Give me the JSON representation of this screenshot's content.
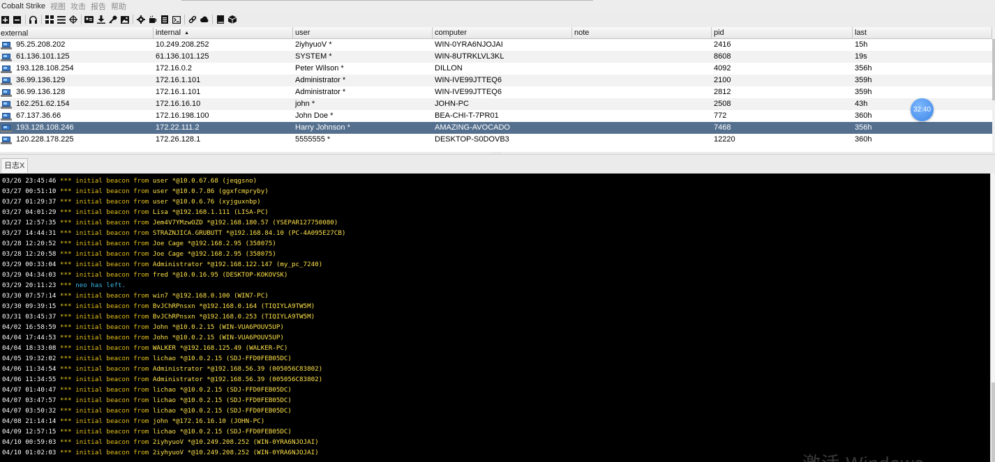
{
  "menubar": {
    "app_name": "Cobalt Strike",
    "items": [
      "视图",
      "攻击",
      "报告",
      "帮助"
    ]
  },
  "toolbar": {
    "icons": [
      "connect-icon",
      "disconnect-icon",
      "headphones-icon",
      "pivot-graph-icon",
      "session-list-icon",
      "target-crosshair-icon",
      "credentials-icon",
      "download-icon",
      "key-icon",
      "screenshot-icon",
      "settings-gear-icon",
      "coffee-icon",
      "document-icon",
      "console-icon",
      "link-icon",
      "cloud-icon",
      "book-icon",
      "cube-icon"
    ]
  },
  "beacon_table": {
    "columns": [
      {
        "key": "external",
        "label": "external"
      },
      {
        "key": "internal",
        "label": "internal",
        "sort": "▲"
      },
      {
        "key": "user",
        "label": "user"
      },
      {
        "key": "computer",
        "label": "computer"
      },
      {
        "key": "note",
        "label": "note"
      },
      {
        "key": "pid",
        "label": "pid"
      },
      {
        "key": "last",
        "label": "last"
      }
    ],
    "rows": [
      {
        "external": "95.25.208.202",
        "internal": "10.249.208.252",
        "user": "2iyhyuoV *",
        "computer": "WIN-0YRA6NJOJAI",
        "note": "",
        "pid": "2416",
        "last": "15h"
      },
      {
        "external": "61.136.101.125",
        "internal": "61.136.101.125",
        "user": "SYSTEM *",
        "computer": "WIN-8UTRKLVL3KL",
        "note": "",
        "pid": "8608",
        "last": "19s"
      },
      {
        "external": "193.128.108.254",
        "internal": "172.16.0.2",
        "user": "Peter Wilson *",
        "computer": "DILLON",
        "note": "",
        "pid": "4092",
        "last": "356h"
      },
      {
        "external": "36.99.136.129",
        "internal": "172.16.1.101",
        "user": "Administrator *",
        "computer": "WIN-IVE99JTTEQ6",
        "note": "",
        "pid": "2100",
        "last": "359h"
      },
      {
        "external": "36.99.136.128",
        "internal": "172.16.1.101",
        "user": "Administrator *",
        "computer": "WIN-IVE99JTTEQ6",
        "note": "",
        "pid": "2812",
        "last": "359h"
      },
      {
        "external": "162.251.62.154",
        "internal": "172.16.16.10",
        "user": "john *",
        "computer": "JOHN-PC",
        "note": "",
        "pid": "2508",
        "last": "43h"
      },
      {
        "external": "67.137.36.66",
        "internal": "172.16.198.100",
        "user": "John Doe *",
        "computer": "BEA-CHI-T-7PR01",
        "note": "",
        "pid": "772",
        "last": "360h"
      },
      {
        "external": "193.128.108.246",
        "internal": "172.22.111.2",
        "user": "Harry Johnson *",
        "computer": "AMAZING-AVOCADO",
        "note": "",
        "pid": "7468",
        "last": "356h",
        "selected": true
      },
      {
        "external": "120.228.178.225",
        "internal": "172.26.128.1",
        "user": "5555555 *",
        "computer": "DESKTOP-S0DOVB3",
        "note": "",
        "pid": "12220",
        "last": "360h"
      }
    ]
  },
  "timer_badge": "32:40",
  "log_tab": {
    "label": "日志X"
  },
  "event_log": [
    {
      "time": "03/26 23:45:46",
      "stars": "***",
      "text": "initial beacon from",
      "who": "user *@10.0.67.68 (jeqgsno)"
    },
    {
      "time": "03/27 00:51:10",
      "stars": "***",
      "text": "initial beacon from",
      "who": "user *@10.0.7.86 (ggxfcmpryby)"
    },
    {
      "time": "03/27 01:29:37",
      "stars": "***",
      "text": "initial beacon from",
      "who": "user *@10.0.6.76 (xyjguxnbp)"
    },
    {
      "time": "03/27 04:01:29",
      "stars": "***",
      "text": "initial beacon from",
      "who": "Lisa *@192.168.1.111 (LISA-PC)"
    },
    {
      "time": "03/27 12:57:35",
      "stars": "***",
      "text": "initial beacon from",
      "who": "Jem4V7YMzwOZD *@192.168.180.57 (YSEPAR127750080)"
    },
    {
      "time": "03/27 14:44:31",
      "stars": "***",
      "text": "initial beacon from",
      "who": "STRAZNJICA.GRUBUTT *@192.168.84.10 (PC-4A095E27CB)"
    },
    {
      "time": "03/28 12:20:52",
      "stars": "***",
      "text": "initial beacon from",
      "who": "Joe Cage *@192.168.2.95 (358075)"
    },
    {
      "time": "03/28 12:20:58",
      "stars": "***",
      "text": "initial beacon from",
      "who": "Joe Cage *@192.168.2.95 (358075)"
    },
    {
      "time": "03/29 00:33:04",
      "stars": "***",
      "text": "initial beacon from",
      "who": "Administrator *@192.168.122.147 (my_pc_7240)"
    },
    {
      "time": "03/29 04:34:03",
      "stars": "***",
      "text": "initial beacon from",
      "who": "fred *@10.0.16.95 (DESKTOP-KOKOVSK)"
    },
    {
      "time": "03/29 20:11:23",
      "stars": "***",
      "text": "neo has left.",
      "who": "",
      "style": "cyan"
    },
    {
      "time": "03/30 07:57:14",
      "stars": "***",
      "text": "initial beacon from",
      "who": "win7 *@192.168.0.100 (WIN7-PC)"
    },
    {
      "time": "03/30 09:39:15",
      "stars": "***",
      "text": "initial beacon from",
      "who": "BvJChRPnsxn *@192.168.0.164 (TIQIYLA9TW5M)"
    },
    {
      "time": "03/31 03:45:37",
      "stars": "***",
      "text": "initial beacon from",
      "who": "BvJChRPnsxn *@192.168.0.253 (TIQIYLA9TW5M)"
    },
    {
      "time": "04/02 16:58:59",
      "stars": "***",
      "text": "initial beacon from",
      "who": "John *@10.0.2.15 (WIN-VUA6POUV5UP)"
    },
    {
      "time": "04/04 17:44:53",
      "stars": "***",
      "text": "initial beacon from",
      "who": "John *@10.0.2.15 (WIN-VUA6POUV5UP)"
    },
    {
      "time": "04/04 18:33:08",
      "stars": "***",
      "text": "initial beacon from",
      "who": "WALKER *@192.168.125.49 (WALKER-PC)"
    },
    {
      "time": "04/05 19:32:02",
      "stars": "***",
      "text": "initial beacon from",
      "who": "lichao *@10.0.2.15 (SDJ-FFD0FEB05DC)"
    },
    {
      "time": "04/06 11:34:54",
      "stars": "***",
      "text": "initial beacon from",
      "who": "Administrator *@192.168.56.39 (005056C83802)"
    },
    {
      "time": "04/06 11:34:55",
      "stars": "***",
      "text": "initial beacon from",
      "who": "Administrator *@192.168.56.39 (005056C83802)"
    },
    {
      "time": "04/07 01:40:47",
      "stars": "***",
      "text": "initial beacon from",
      "who": "lichao *@10.0.2.15 (SDJ-FFD0FEB05DC)"
    },
    {
      "time": "04/07 03:47:57",
      "stars": "***",
      "text": "initial beacon from",
      "who": "lichao *@10.0.2.15 (SDJ-FFD0FEB05DC)"
    },
    {
      "time": "04/07 03:50:32",
      "stars": "***",
      "text": "initial beacon from",
      "who": "lichao *@10.0.2.15 (SDJ-FFD0FEB05DC)"
    },
    {
      "time": "04/08 21:14:14",
      "stars": "***",
      "text": "initial beacon from",
      "who": "john *@172.16.16.10 (JOHN-PC)"
    },
    {
      "time": "04/09 12:57:15",
      "stars": "***",
      "text": "initial beacon from",
      "who": "lichao *@10.0.2.15 (SDJ-FFD0FEB05DC)"
    },
    {
      "time": "04/10 00:59:03",
      "stars": "***",
      "text": "initial beacon from",
      "who": "2iyhyuoV *@10.249.208.252 (WIN-0YRA6NJOJAI)"
    },
    {
      "time": "04/10 01:02:03",
      "stars": "***",
      "text": "initial beacon from",
      "who": "2iyhyuoV *@10.249.208.252 (WIN-0YRA6NJOJAI)"
    }
  ],
  "watermark": "激活 Windows"
}
